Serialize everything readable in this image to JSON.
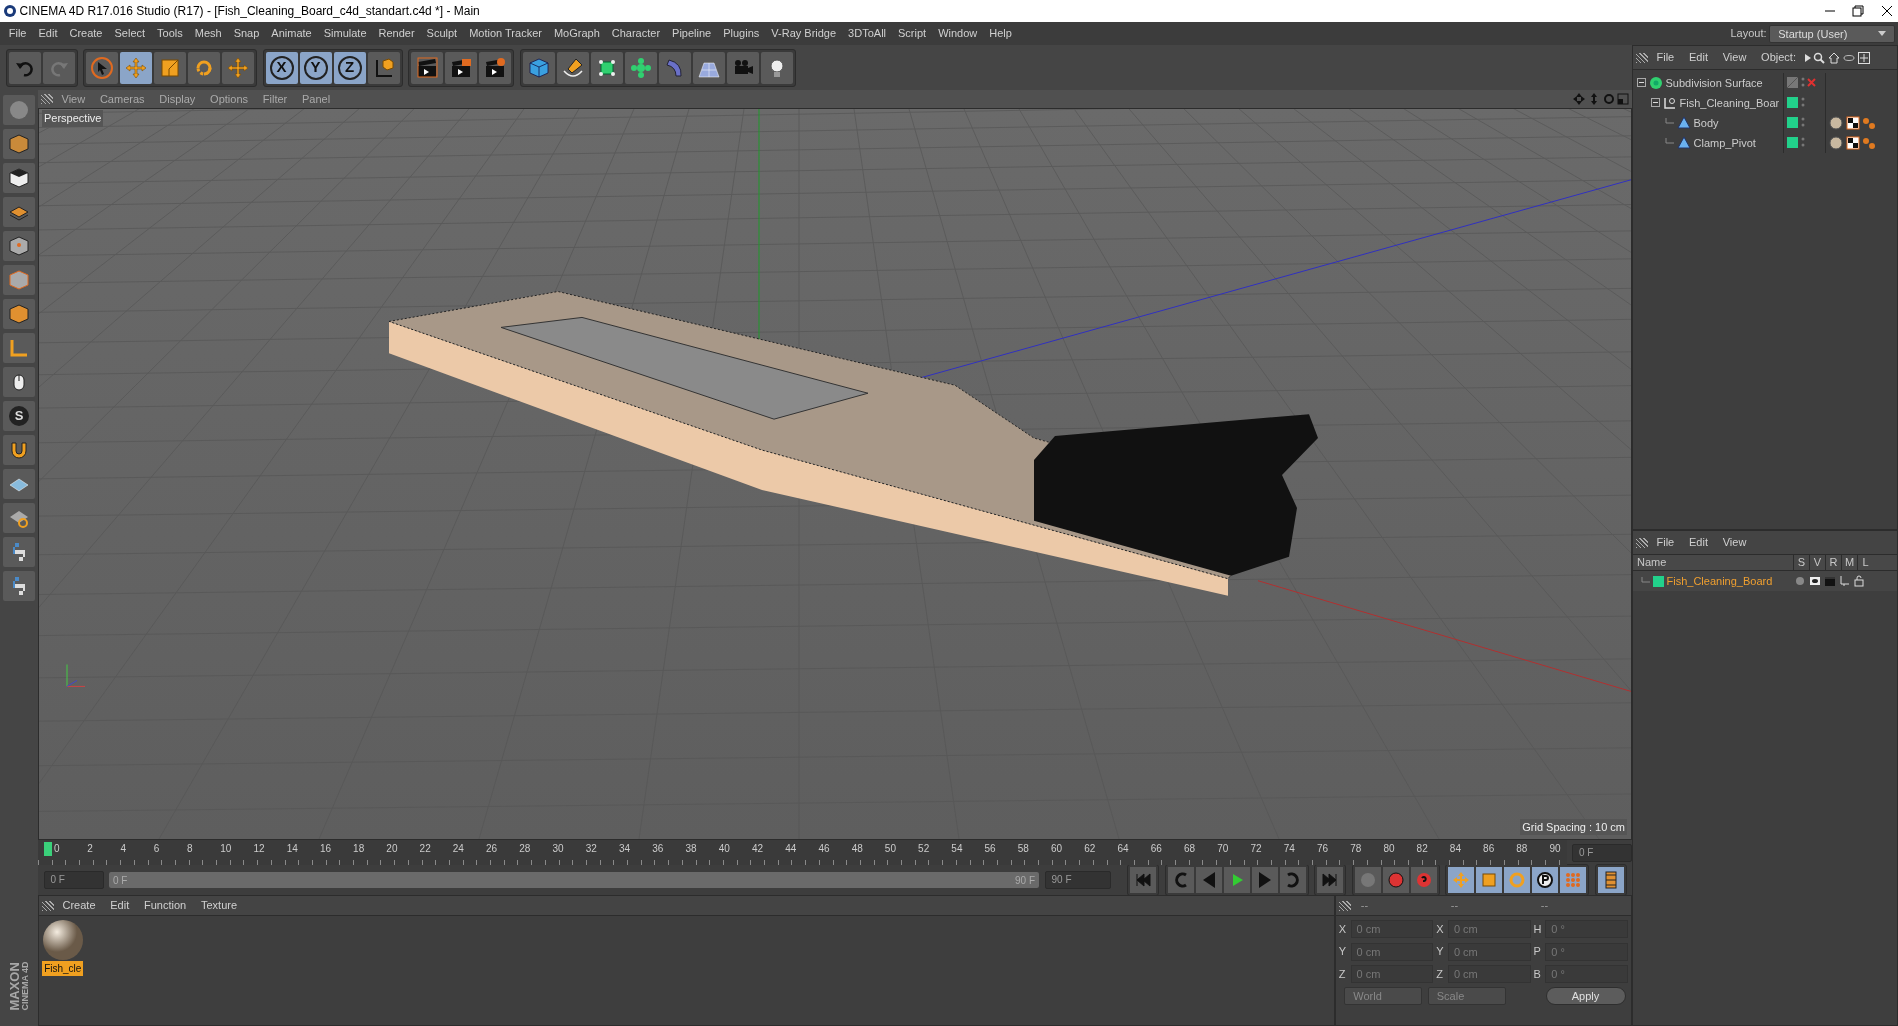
{
  "window": {
    "title": "CINEMA 4D R17.016 Studio (R17) - [Fish_Cleaning_Board_c4d_standart.c4d *] - Main"
  },
  "menu_bar": [
    "File",
    "Edit",
    "Create",
    "Select",
    "Tools",
    "Mesh",
    "Snap",
    "Animate",
    "Simulate",
    "Render",
    "Sculpt",
    "Motion Tracker",
    "MoGraph",
    "Character",
    "Pipeline",
    "Plugins",
    "V-Ray Bridge",
    "3DToAll",
    "Script",
    "Window",
    "Help"
  ],
  "layout": {
    "label": "Layout:",
    "value": "Startup (User)"
  },
  "axis_buttons": [
    "X",
    "Y",
    "Z"
  ],
  "left_toolbar": {
    "snap_label": "S"
  },
  "viewport": {
    "menu": [
      "View",
      "Cameras",
      "Display",
      "Options",
      "Filter",
      "Panel"
    ],
    "camera_label": "Perspective",
    "grid_spacing": "Grid Spacing : 10 cm"
  },
  "timeline": {
    "ticks": [
      "0",
      "2",
      "4",
      "6",
      "8",
      "10",
      "12",
      "14",
      "16",
      "18",
      "20",
      "22",
      "24",
      "26",
      "28",
      "30",
      "32",
      "34",
      "36",
      "38",
      "40",
      "42",
      "44",
      "46",
      "48",
      "50",
      "52",
      "54",
      "56",
      "58",
      "60",
      "62",
      "64",
      "66",
      "68",
      "70",
      "72",
      "74",
      "76",
      "78",
      "80",
      "82",
      "84",
      "86",
      "88",
      "90"
    ],
    "current_frame": "0 F",
    "start_field": "0 F",
    "range_start": "0 F",
    "range_end": "90 F",
    "range_slider": {
      "level": 1
    },
    "end_field": "90 F"
  },
  "material_manager": {
    "menu": [
      "Create",
      "Edit",
      "Function",
      "Texture"
    ],
    "materials": [
      {
        "name": "Fish_cle",
        "selected": true
      }
    ]
  },
  "coordinates": {
    "headers": [
      "--",
      "--",
      "--"
    ],
    "rows": [
      {
        "pos_label": "X",
        "pos": "0 cm",
        "size_label": "X",
        "size": "0 cm",
        "rot_label": "H",
        "rot": "0 °"
      },
      {
        "pos_label": "Y",
        "pos": "0 cm",
        "size_label": "Y",
        "size": "0 cm",
        "rot_label": "P",
        "rot": "0 °"
      },
      {
        "pos_label": "Z",
        "pos": "0 cm",
        "size_label": "Z",
        "size": "0 cm",
        "rot_label": "B",
        "rot": "0 °"
      }
    ],
    "mode": "World",
    "size_mode": "Scale",
    "apply": "Apply"
  },
  "brand": {
    "line1": "MAXON",
    "line2": "CINEMA 4D"
  },
  "object_manager": {
    "menu": [
      "File",
      "Edit",
      "View",
      "Object:"
    ],
    "objects": [
      {
        "name": "Subdivision Surface",
        "kind": "generator",
        "expanded": true,
        "children": [
          {
            "name": "Fish_Cleaning_Boar",
            "kind": "null",
            "expanded": true,
            "color": "#22d18b",
            "children": [
              {
                "name": "Body",
                "kind": "polygon",
                "color": "#22d18b",
                "tags": [
                  {
                    "kind": "material"
                  },
                  {
                    "kind": "texture"
                  },
                  {
                    "kind": "phong"
                  }
                ]
              },
              {
                "name": "Clamp_Pivot",
                "kind": "polygon",
                "color": "#22d18b",
                "tags": [
                  {
                    "kind": "material"
                  },
                  {
                    "kind": "texture"
                  },
                  {
                    "kind": "phong"
                  }
                ]
              }
            ]
          }
        ]
      }
    ]
  },
  "layer_manager": {
    "menu": [
      "File",
      "Edit",
      "View"
    ],
    "columns": [
      "Name",
      "S",
      "V",
      "R",
      "M",
      "L"
    ],
    "layers": [
      {
        "name": "Fish_Cleaning_Board",
        "color": "#22d18b"
      }
    ]
  }
}
